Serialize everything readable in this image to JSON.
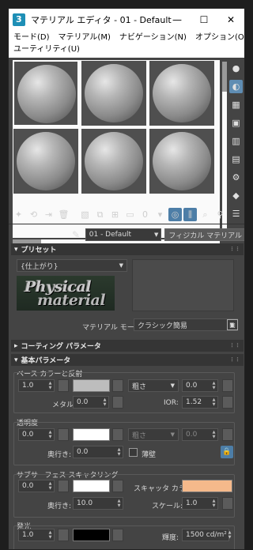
{
  "window": {
    "title": "マテリアル エディタ - 01 - Default",
    "btn_min": "—",
    "btn_max": "☐",
    "btn_close": "✕"
  },
  "menu": [
    "モード(D)",
    "マテリアル(M)",
    "ナビゲーション(N)",
    "オプション(O)",
    "ユーティリティ(U)"
  ],
  "material": {
    "name": "01 - Default",
    "type": "フィジカル マテリアル"
  },
  "preset_rollout": {
    "title": "プリセット",
    "preset_value": "{仕上がり}",
    "logo_line1": "Physical",
    "logo_line2": "material",
    "mode_label": "マテリアル モード:",
    "mode_value": "クラシック簡易"
  },
  "coating_rollout": {
    "title": "コーティング パラメータ"
  },
  "basic_rollout": {
    "title": "基本パラメータ",
    "base": {
      "title": "ベース カラーと反射",
      "weight": "1.0",
      "color": "#bdbdbd",
      "roughness_mode": "粗さ",
      "roughness": "0.0",
      "metalness_label": "メタル:",
      "metalness": "0.0",
      "ior_label": "IOR:",
      "ior": "1.52"
    },
    "transparency": {
      "title": "透明度",
      "weight": "0.0",
      "color": "#ffffff",
      "roughness_mode": "粗さ",
      "roughness": "0.0",
      "depth_label": "奥行き:",
      "depth": "0.0",
      "thin_label": "薄壁"
    },
    "sss": {
      "title": "サブサーフェス スキャタリング",
      "weight": "0.0",
      "color": "#ffffff",
      "scatter_label": "スキャッタ カラー:",
      "scatter_color": "#f5b98b",
      "depth_label": "奥行き:",
      "depth": "10.0",
      "scale_label": "スケール:",
      "scale": "1.0"
    },
    "emission": {
      "title": "発光",
      "weight": "1.0",
      "color": "#000000",
      "luminance_label": "輝度:",
      "luminance": "1500 cd/m²"
    }
  },
  "colors": {
    "panel": "#444444",
    "active_tool": "#4d7ea7",
    "scatter_swatch": "#f5b98b"
  }
}
